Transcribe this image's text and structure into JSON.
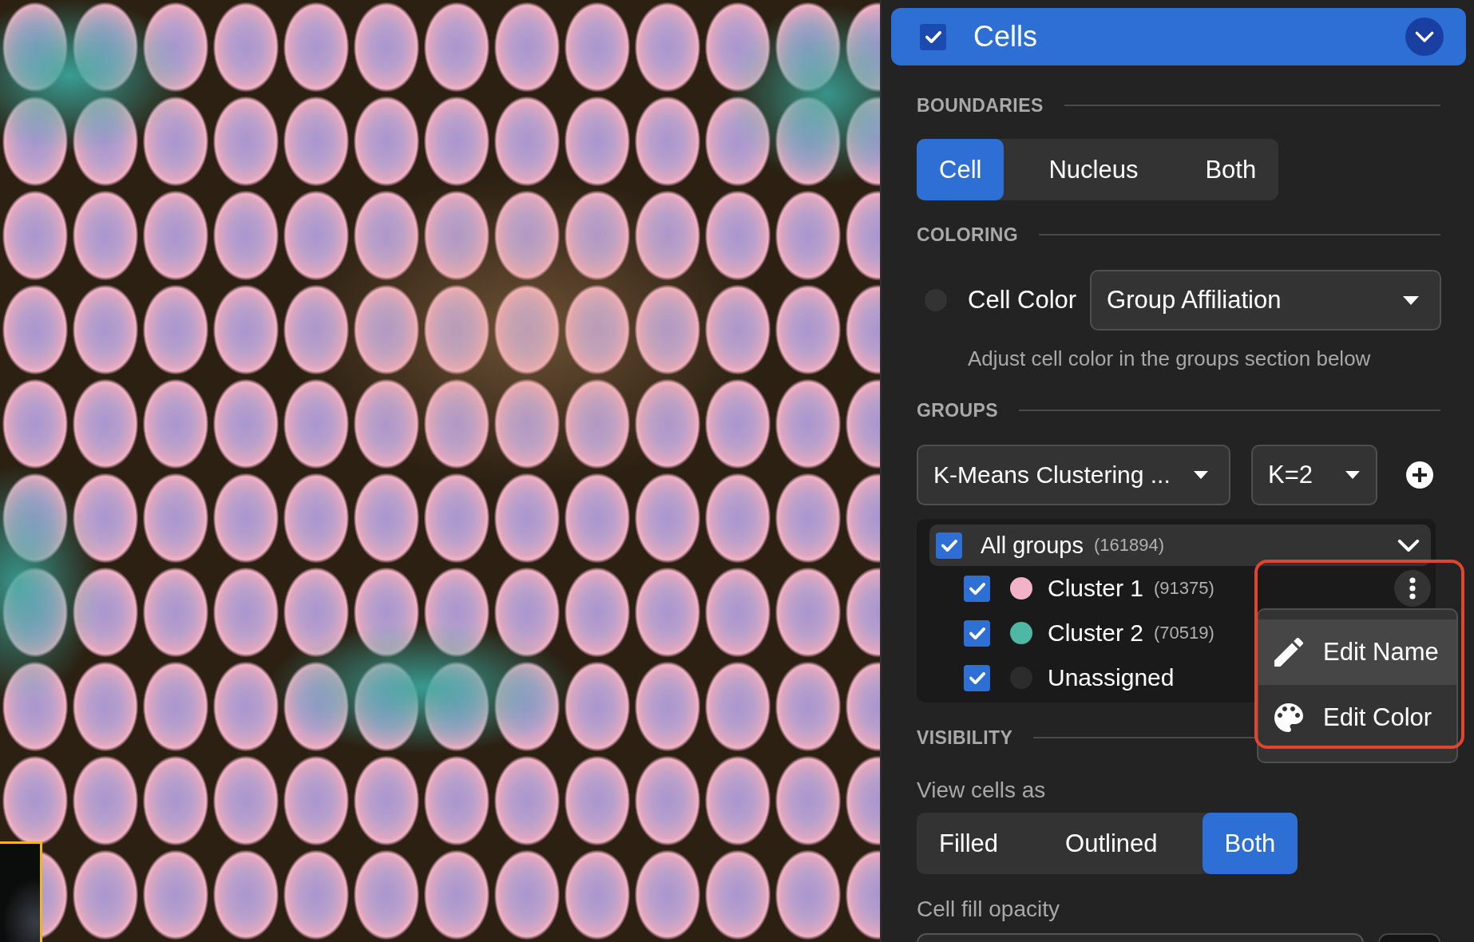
{
  "layer": {
    "title": "Cells",
    "checked": true,
    "expanded": true
  },
  "boundaries": {
    "heading": "BOUNDARIES",
    "options": [
      {
        "label": "Cell",
        "selected": true
      },
      {
        "label": "Nucleus",
        "selected": false
      },
      {
        "label": "Both",
        "selected": false
      }
    ]
  },
  "coloring": {
    "heading": "COLORING",
    "label": "Cell Color",
    "dropdown": {
      "value": "Group Affiliation"
    },
    "hint": "Adjust cell color in the groups section below"
  },
  "groups": {
    "heading": "GROUPS",
    "method": {
      "value": "K-Means Clustering ..."
    },
    "k": {
      "value": "K=2"
    },
    "all": {
      "label": "All groups",
      "count": "(161894)",
      "checked": true,
      "expanded": true
    },
    "items": [
      {
        "label": "Cluster 1",
        "count": "(91375)",
        "checked": true,
        "color": "#f2b3c9",
        "menu_open": true
      },
      {
        "label": "Cluster 2",
        "count": "(70519)",
        "checked": true,
        "color": "#4fb8a5",
        "menu_open": false
      },
      {
        "label": "Unassigned",
        "checked": true,
        "color": "#2c2c2c",
        "menu_open": false
      }
    ]
  },
  "context_menu": {
    "items": [
      {
        "label": "Edit Name",
        "highlighted": true
      },
      {
        "label": "Edit Color",
        "highlighted": false
      }
    ]
  },
  "visibility": {
    "heading": "VISIBILITY",
    "view_label": "View cells as",
    "options": [
      {
        "label": "Filled",
        "selected": false
      },
      {
        "label": "Outlined",
        "selected": false
      },
      {
        "label": "Both",
        "selected": true
      }
    ],
    "opacity_label": "Cell fill opacity"
  }
}
